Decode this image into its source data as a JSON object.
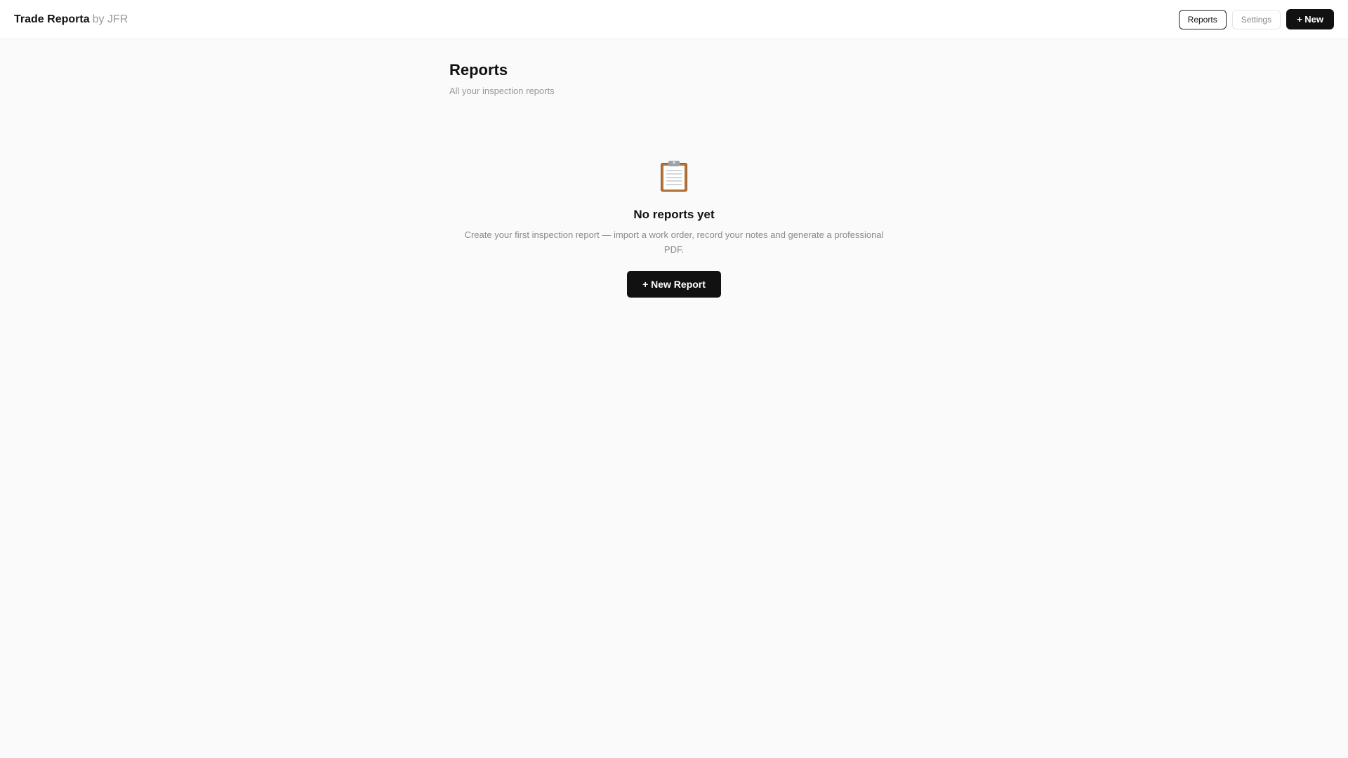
{
  "header": {
    "brand_name": "Trade Reporta",
    "brand_by": "by JFR",
    "nav": {
      "reports_label": "Reports",
      "settings_label": "Settings",
      "new_label": "+ New"
    }
  },
  "main": {
    "title": "Reports",
    "subtitle": "All your inspection reports",
    "empty_state": {
      "icon": "clipboard-icon",
      "title": "No reports yet",
      "description": "Create your first inspection report — import a work order, record your notes and generate a professional PDF.",
      "button_label": "+ New Report"
    }
  },
  "colors": {
    "background": "#fafafa",
    "primary": "#111111",
    "muted_text": "#999999"
  }
}
